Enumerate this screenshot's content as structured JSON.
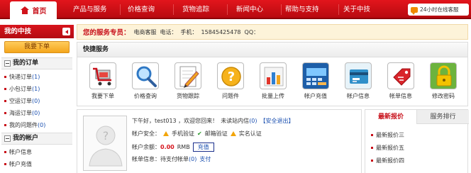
{
  "nav": {
    "home": "首页",
    "items": [
      "产品与服务",
      "价格查询",
      "货物追踪",
      "新闻中心",
      "帮助与支持",
      "关于中技"
    ],
    "service": "24小时在线客服"
  },
  "sidebar": {
    "title": "我的中技",
    "order_button": "我要下单",
    "sections": [
      {
        "title": "我的订单",
        "links": [
          {
            "label": "快递订单",
            "count": "(1)"
          },
          {
            "label": "小包订单",
            "count": "(1)"
          },
          {
            "label": "空运订单",
            "count": "(0)"
          },
          {
            "label": "海运订单",
            "count": "(0)"
          },
          {
            "label": "我的问题件",
            "count": "(0)"
          }
        ]
      },
      {
        "title": "我的帐户",
        "links": [
          {
            "label": "帐户信息",
            "count": ""
          },
          {
            "label": "帐户充值",
            "count": ""
          }
        ]
      }
    ]
  },
  "contact": {
    "title": "您的服务专员：",
    "name": "电商客服",
    "phone_label": "电话：",
    "mobile_label": "手机：",
    "mobile": "15845425478",
    "qq_label": "QQ："
  },
  "quick": {
    "title": "快捷服务",
    "items": [
      {
        "label": "我要下单",
        "icon": "shopping-cart-icon"
      },
      {
        "label": "价格查询",
        "icon": "magnifier-icon"
      },
      {
        "label": "货物跟踪",
        "icon": "notepad-pencil-icon"
      },
      {
        "label": "问题件",
        "icon": "question-icon"
      },
      {
        "label": "批量上传",
        "icon": "bar-chart-icon"
      },
      {
        "label": "帐户充值",
        "icon": "calculator-icon"
      },
      {
        "label": "帐户信息",
        "icon": "card-icon"
      },
      {
        "label": "帐单信息",
        "icon": "price-tag-icon"
      },
      {
        "label": "修改密码",
        "icon": "padlock-icon"
      }
    ]
  },
  "account": {
    "greeting": "下午好，test013 ，欢迎您回来！",
    "unread_label": "未读站内信",
    "unread_count": "(0)",
    "logout": "【安全退出】",
    "security_label": "帐户安全：",
    "security": [
      "手机验证",
      "邮箱验证",
      "实名认证"
    ],
    "balance_label": "帐户余额：",
    "balance": "0.00",
    "currency": "RMB",
    "recharge": "充值",
    "bill_label": "帐单信息：待支付帐单",
    "bill_count": "(0)",
    "pay": "支付"
  },
  "right_panel": {
    "tabs": [
      "最新报价",
      "服务排行"
    ],
    "quotes": [
      "最新报价三",
      "最新报价五",
      "最新报价四"
    ]
  },
  "colors": {
    "brand_red": "#c8101a",
    "link_blue": "#1a4fb0",
    "warn_orange": "#f2a50a"
  }
}
